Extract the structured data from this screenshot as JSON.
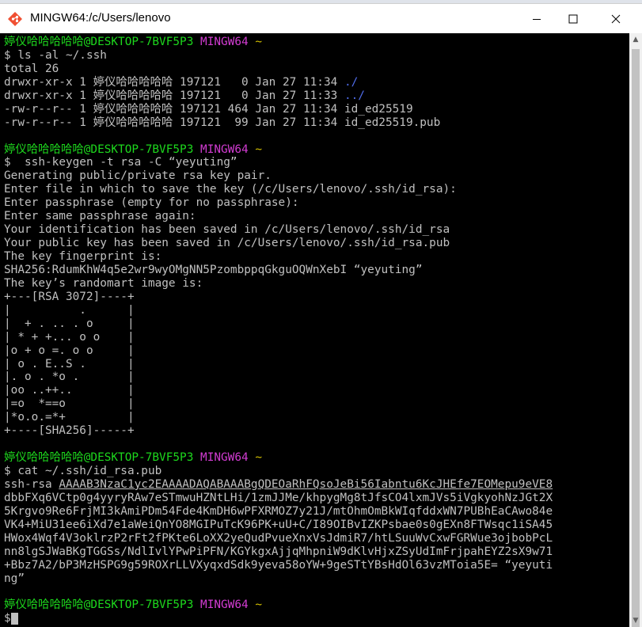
{
  "window": {
    "title": "MINGW64:/c/Users/lenovo",
    "icons": {
      "app": "git-bash-diamond-icon",
      "minimize": "minimize-icon",
      "maximize": "maximize-icon",
      "close": "close-icon"
    }
  },
  "prompt": {
    "user_host": "婷仪哈哈哈哈哈@DESKTOP-7BVF5P3",
    "env": "MINGW64",
    "dir": "~",
    "symbol": "$"
  },
  "colors": {
    "user_host": "#1dd81d",
    "env": "#d23cd2",
    "dir": "#d4c000",
    "text": "#c0c0c0",
    "dir_entry": "#4f6be8",
    "background": "#000000"
  },
  "terminal": {
    "blocks": [
      {
        "command": " ls -al ~/.ssh",
        "output": [
          "total 26",
          {
            "text": "drwxr-xr-x 1 婷仪哈哈哈哈哈 197121   0 Jan 27 11:34 ",
            "highlight": "./"
          },
          {
            "text": "drwxr-xr-x 1 婷仪哈哈哈哈哈 197121   0 Jan 27 11:33 ",
            "highlight": "../"
          },
          "-rw-r--r-- 1 婷仪哈哈哈哈哈 197121 464 Jan 27 11:34 id_ed25519",
          "-rw-r--r-- 1 婷仪哈哈哈哈哈 197121  99 Jan 27 11:34 id_ed25519.pub",
          ""
        ]
      },
      {
        "command": "  ssh-keygen -t rsa -C “yeyuting”",
        "output": [
          "Generating public/private rsa key pair.",
          "Enter file in which to save the key (/c/Users/lenovo/.ssh/id_rsa):",
          "Enter passphrase (empty for no passphrase):",
          "Enter same passphrase again:",
          "Your identification has been saved in /c/Users/lenovo/.ssh/id_rsa",
          "Your public key has been saved in /c/Users/lenovo/.ssh/id_rsa.pub",
          "The key fingerprint is:",
          "SHA256:RdumKhW4q5e2wr9wyOMgNN5PzombppqGkguOQWnXebI “yeyuting”",
          "The key’s randomart image is:",
          "+---[RSA 3072]----+",
          "|          .      |",
          "|  + . .. . o     |",
          "| * + +... o o    |",
          "|o + o =. o o     |",
          "| o . E..S .      |",
          "|. o . *o .       |",
          "|oo ..++..        |",
          "|=o  *==o         |",
          "|*o.o.=*+         |",
          "+----[SHA256]-----+",
          ""
        ]
      },
      {
        "command": " cat ~/.ssh/id_rsa.pub",
        "output": [
          {
            "text": "ssh-rsa ",
            "underline": "AAAAB3NzaC1yc2EAAAADAQABAAABgQDEOaRhFQsoJeBi56Iabntu6KcJHEfe7EOMepu9eVE8"
          },
          "dbbFXq6VCtp0g4yyryRAw7eSTmwuHZNtLHi/1zmJJMe/khpygMg8tJfsCO4lxmJVs5iVgkyohNzJGt2X",
          "5Krgvo9Re6FrjMI3kAmiPDm54Fde4KmDH6wPFXRMOZ7y21J/mtOhmOmBkWIqfddxWN7PUBhEaCAwo84e",
          "VK4+MiU31ee6iXd7e1aWeiQnYO8MGIPuTcK96PK+uU+C/I89OIBvIZKPsbae0s0gEXn8FTWsqc1iSA45",
          "HWox4Wqf4V3oklrzP2rFt2fPKte6LoXX2yeQudPvueXnxVsJdmiR7/htLSuuWvCxwFGRWue3ojbobPcL",
          "nn8lgSJWaBKgTGGSs/NdlIvlYPwPiPFN/KGYkgxAjjqMhpniW9dKlvHjxZSyUdImFrjpahEYZ2sX9w71",
          "+Bbz7A2/bP3MzHSPG9g59ROXrLLVXyqxdSdk9yeva58oYW+9geSTtYBsHdOl63vzMToia5E= “yeyuti",
          "ng”",
          ""
        ]
      }
    ],
    "final_prompt_symbol": "$"
  }
}
